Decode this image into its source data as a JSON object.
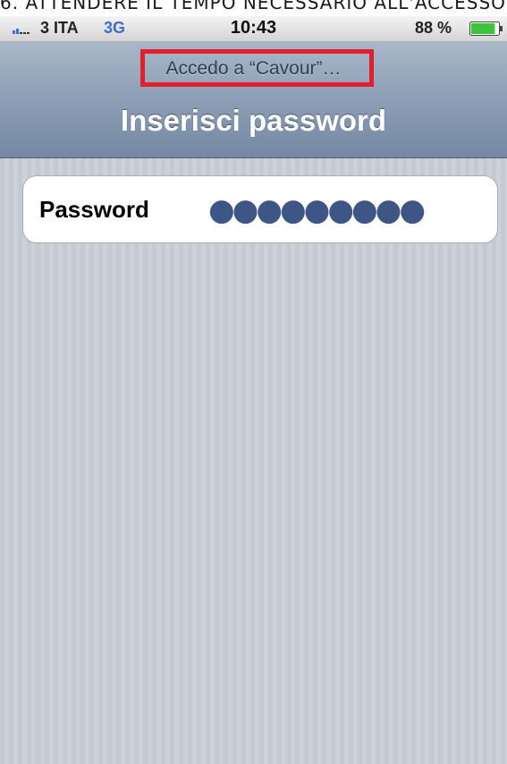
{
  "caption": {
    "text": "6. ATTENDERE IL TEMPO NECESSARIO ALL'ACCESSO"
  },
  "status_bar": {
    "carrier": "3 ITA",
    "network": "3G",
    "time": "10:43",
    "battery": "88 %",
    "battery_level": 0.88,
    "signal_icon": "signal-bars-icon",
    "battery_icon": "battery-icon"
  },
  "nav": {
    "prompt": "Accedo a “Cavour”…",
    "title": "Inserisci password",
    "highlight_color": "#e0202a"
  },
  "form": {
    "password_label": "Password",
    "password_value": "●●●●●●●●●"
  }
}
